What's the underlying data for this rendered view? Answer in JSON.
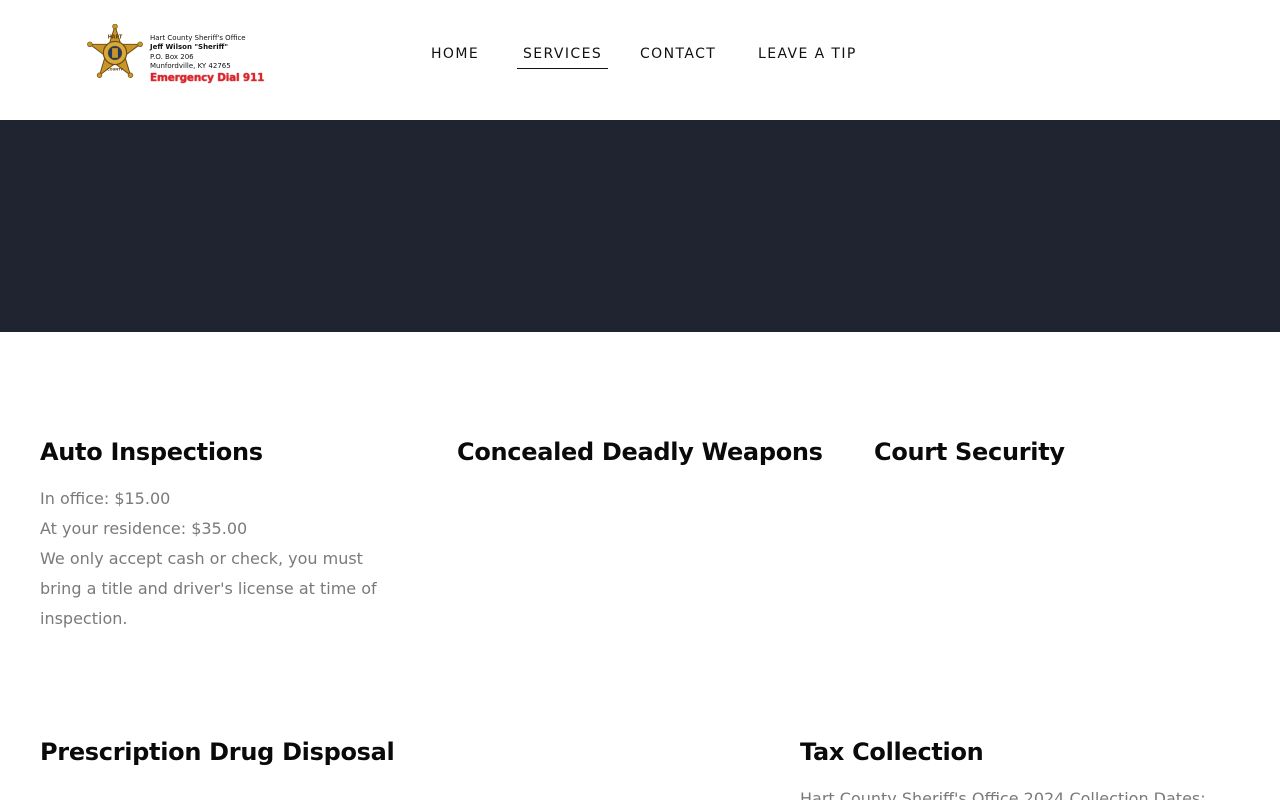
{
  "header": {
    "logo": {
      "badge_text_top": "HART",
      "badge_text_bottom": "COUNTY",
      "lines": [
        "Hart County Sheriff's Office",
        "Jeff Wilson \"Sheriff\"",
        "P.O. Box 206",
        "Munfordville, KY  42765"
      ],
      "emergency": "Emergency Dial 911"
    },
    "nav": [
      {
        "label": "HOME",
        "active": false
      },
      {
        "label": "SERVICES",
        "active": true
      },
      {
        "label": "CONTACT",
        "active": false
      },
      {
        "label": "LEAVE A TIP",
        "active": false
      }
    ]
  },
  "hero": {
    "color": "#1f2430"
  },
  "services": [
    {
      "title": "Auto Inspections",
      "body": [
        "In office: $15.00",
        "At your residence: $35.00",
        "We only accept cash or check, you must",
        "bring a title and driver's license at time of",
        "inspection."
      ]
    },
    {
      "title": "Concealed Deadly Weapons",
      "body": []
    },
    {
      "title": "Court Security",
      "body": []
    },
    {
      "title": "Prescription Drug Disposal",
      "body": []
    },
    {
      "title": "Tax Collection",
      "body": [
        "Hart County Sheriff's Office 2024 Collection Dates:"
      ]
    }
  ],
  "colors": {
    "badge_gold": "#c9952b",
    "emergency_red": "#e0232a",
    "body_text": "#7a7a7a"
  }
}
